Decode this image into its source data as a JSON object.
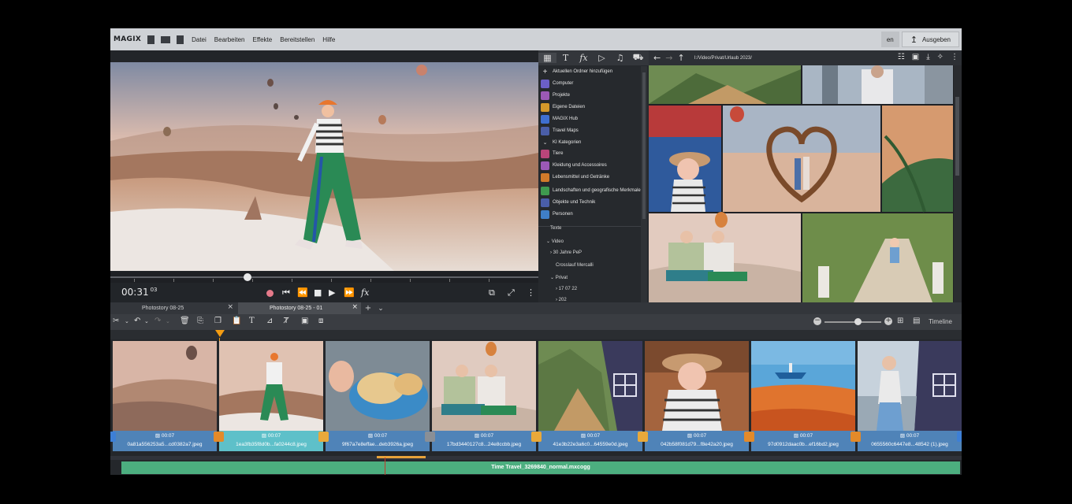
{
  "app": {
    "logo": "MAGIX"
  },
  "menu": [
    "Datei",
    "Bearbeiten",
    "Effekte",
    "Bereitstellen",
    "Hilfe"
  ],
  "header_buttons": {
    "partial_label": "en",
    "export_label": "Ausgeben"
  },
  "preview": {
    "timecode": "00:31",
    "timecode_frames": "03"
  },
  "pool": {
    "add_folder": "Aktuellen Ordner hinzufügen",
    "items": [
      {
        "label": "Computer",
        "color": "#6b5fc7"
      },
      {
        "label": "Projekte",
        "color": "#9b59b6"
      },
      {
        "label": "Eigene Dateien",
        "color": "#d4982a"
      },
      {
        "label": "MAGIX Hub",
        "color": "#3f6fd0"
      },
      {
        "label": "Travel Maps",
        "color": "#4a5ea8"
      }
    ],
    "ki_header": "KI Kategorien",
    "ki_items": [
      {
        "label": "Tiere",
        "color": "#b8457a"
      },
      {
        "label": "Kleidung und Accessoires",
        "color": "#9b59b6"
      },
      {
        "label": "Lebensmittel und Getränke",
        "color": "#d17a2a"
      },
      {
        "label": "Landschaften und geografische Merkmale",
        "color": "#3f9a4f"
      },
      {
        "label": "Objekte und Technik",
        "color": "#4a5ea8"
      },
      {
        "label": "Personen",
        "color": "#3f7fc7"
      }
    ],
    "tree": [
      "Texte",
      "Video",
      "30 Jahre PeP",
      "Crosslauf Mercalli",
      "Privat",
      "17 07 22",
      "202"
    ]
  },
  "browser": {
    "path": "I:/Video/Privat/Urlaub 2023/"
  },
  "tabs": [
    {
      "label": "Photostory 08-25"
    },
    {
      "label": "Photostory 08-25 - 01"
    }
  ],
  "toolbar": {
    "view_label": "Timeline"
  },
  "clips": [
    {
      "duration": "00:07",
      "filename": "0a81a556253a5...cd0382a7.jpeg"
    },
    {
      "duration": "00:07",
      "filename": "1ea3fb35f8d0b...fa0244c8.jpeg"
    },
    {
      "duration": "00:07",
      "filename": "9f67a7e8effae...deb3926a.jpeg"
    },
    {
      "duration": "00:07",
      "filename": "17bd3440127c8...24e8ccbb.jpeg"
    },
    {
      "duration": "00:07",
      "filename": "41e3b22e3a6c0...64559e0d.jpeg"
    },
    {
      "duration": "00:07",
      "filename": "042b58f081d79...f8e42a20.jpeg"
    },
    {
      "duration": "00:07",
      "filename": "97d0912daac0b...ef16bd2.jpeg"
    },
    {
      "duration": "00:07",
      "filename": "0655560c6447e8...48542 (1).jpeg"
    }
  ],
  "audio": {
    "filename": "Time Travel_3269840_normal.mxcogg"
  },
  "colors": {
    "accent": "#f39c12",
    "clip": "#4f83b8",
    "clip_selected": "#5ec0c9",
    "audio": "#4cae7f"
  }
}
